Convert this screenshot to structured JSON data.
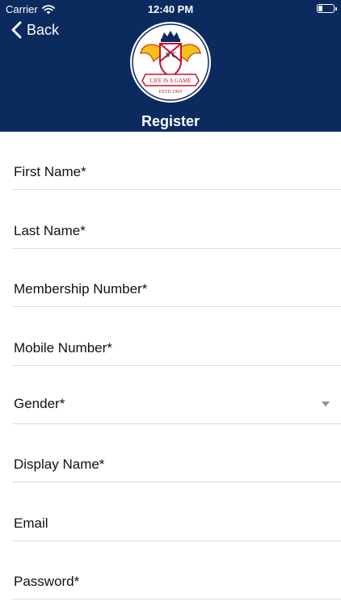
{
  "status_bar": {
    "carrier": "Carrier",
    "time": "12:40 PM",
    "battery_level": 0.25
  },
  "nav": {
    "back_label": "Back",
    "title": "Register"
  },
  "logo": {
    "letters": [
      "S",
      "C"
    ],
    "motto": "LIFE IS A GAME",
    "established": "ESTD 1965"
  },
  "form": {
    "fields": [
      {
        "label": "First Name*",
        "type": "text"
      },
      {
        "label": "Last Name*",
        "type": "text"
      },
      {
        "label": "Membership Number*",
        "type": "text"
      },
      {
        "label": "Mobile Number*",
        "type": "text"
      },
      {
        "label": "Gender*",
        "type": "select"
      },
      {
        "label": "Display Name*",
        "type": "text"
      },
      {
        "label": "Email",
        "type": "text"
      },
      {
        "label": "Password*",
        "type": "password"
      }
    ]
  },
  "colors": {
    "header_bg": "#0b2a5e",
    "divider": "#dcdcdc"
  }
}
